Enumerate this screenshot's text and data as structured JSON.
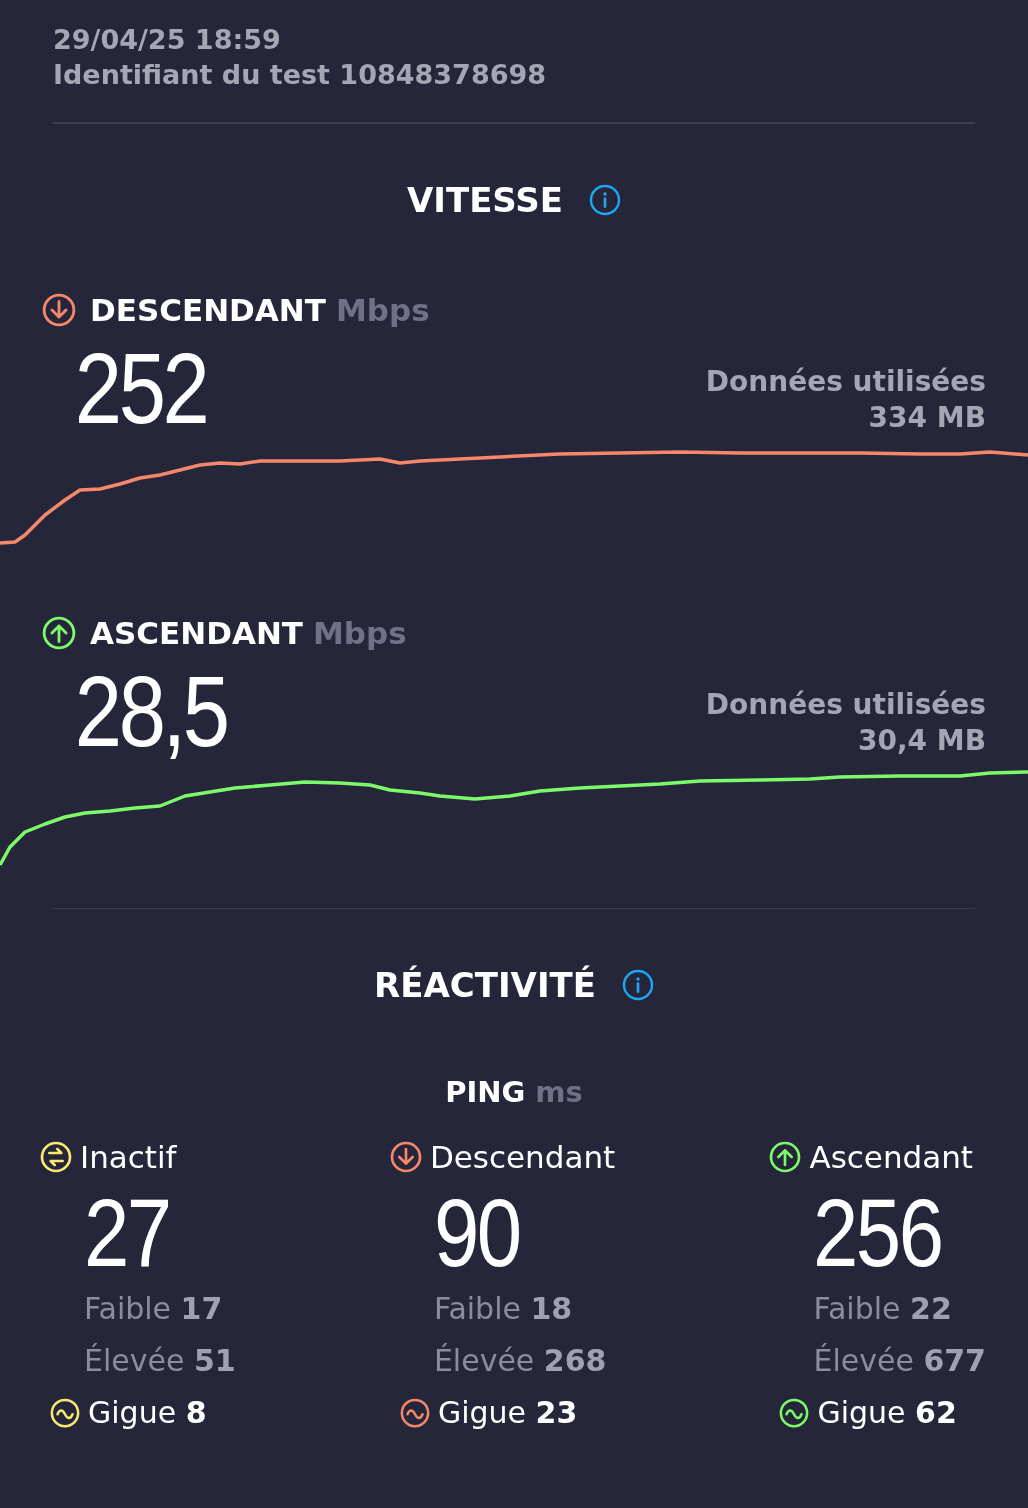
{
  "header": {
    "datetime": "29/04/25 18:59",
    "test_id": "Identifiant du test 10848378698"
  },
  "speed": {
    "title": "VITESSE",
    "tests": [
      {
        "kind": "down",
        "color": "#f5876a",
        "label": "DESCENDANT",
        "unit": "Mbps",
        "value": "252",
        "data_label": "Données utilisées",
        "data_value": "334 MB"
      },
      {
        "kind": "up",
        "color": "#7dfa6a",
        "label": "ASCENDANT",
        "unit": "Mbps",
        "value": "28,5",
        "data_label": "Données utilisées",
        "data_value": "30,4 MB"
      }
    ]
  },
  "responsiveness": {
    "title": "RÉACTIVITÉ",
    "ping_label": "PING",
    "ping_unit": "ms",
    "columns": [
      {
        "kind": "idle",
        "color": "#f7ea6e",
        "label": "Inactif",
        "value": "27",
        "low": "Faible **17**",
        "high": "Élevée **51**",
        "jitter": "Gigue **8**"
      },
      {
        "kind": "down",
        "color": "#f5876a",
        "label": "Descendant",
        "value": "90",
        "low": "Faible **18**",
        "high": "Élevée **268**",
        "jitter": "Gigue **23**"
      },
      {
        "kind": "up",
        "color": "#7dfa6a",
        "label": "Ascendant",
        "value": "256",
        "low": "Faible **22**",
        "high": "Élevée **677**",
        "jitter": "Gigue **62**"
      }
    ]
  }
}
